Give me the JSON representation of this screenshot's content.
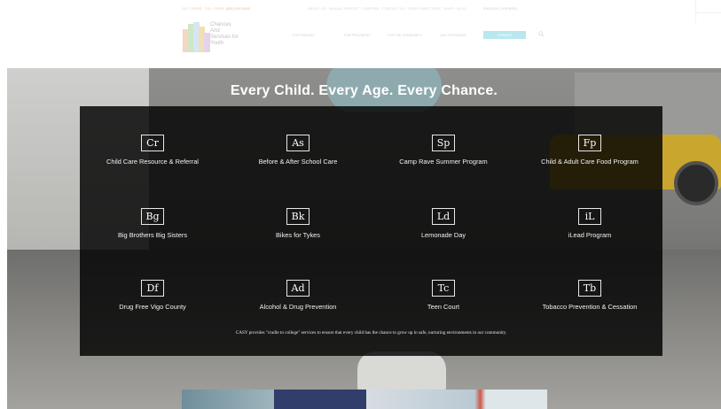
{
  "header": {
    "topbar_left_prefix": "24/7 CRISIS · TOLL FREE:",
    "topbar_left_phone": "(800) 000-0000",
    "topbar_mid": "ABOUT US · ANNUAL REPORT · CAREERS · CONTACT US · STAFF DIRECTORY · SHOP · BLOG",
    "topbar_lang": "ENGLISH | ESPAÑOL",
    "logo_lines": [
      "Chances",
      "And",
      "Services for",
      "Youth"
    ],
    "nav": [
      "FOR FAMILIES",
      "FOR PROVIDERS",
      "FOR THE COMMUNITY",
      "OUR PROGRAMS"
    ],
    "donate_label": "DONATE"
  },
  "hero": {
    "headline": "Every Child. Every Age. Every Chance.",
    "tagline": "CASY provides \"cradle to college\" services to ensure that every child has the chance to grow up in safe, nurturing environments in our community.",
    "programs": [
      {
        "code": "Cr",
        "label": "Child Care Resource & Referral"
      },
      {
        "code": "As",
        "label": "Before & After School Care"
      },
      {
        "code": "Sp",
        "label": "Camp Rave Summer Program"
      },
      {
        "code": "Fp",
        "label": "Child & Adult Care Food Program"
      },
      {
        "code": "Bg",
        "label": "Big Brothers Big Sisters"
      },
      {
        "code": "Bk",
        "label": "Bikes for Tykes"
      },
      {
        "code": "Ld",
        "label": "Lemonade Day"
      },
      {
        "code": "iL",
        "label": "iLead Program"
      },
      {
        "code": "Df",
        "label": "Drug Free Vigo County"
      },
      {
        "code": "Ad",
        "label": "Alcohol & Drug Prevention"
      },
      {
        "code": "Tc",
        "label": "Teen Court"
      },
      {
        "code": "Tb",
        "label": "Tobacco Prevention & Cessation"
      }
    ]
  },
  "colors": {
    "overlay": "#000000",
    "donate": "#b9e7ee",
    "car": "#c9a62e",
    "phone_accent": "#f1b48c"
  },
  "icons": {
    "search": "search-icon",
    "logo": "logo-mark-icon"
  }
}
